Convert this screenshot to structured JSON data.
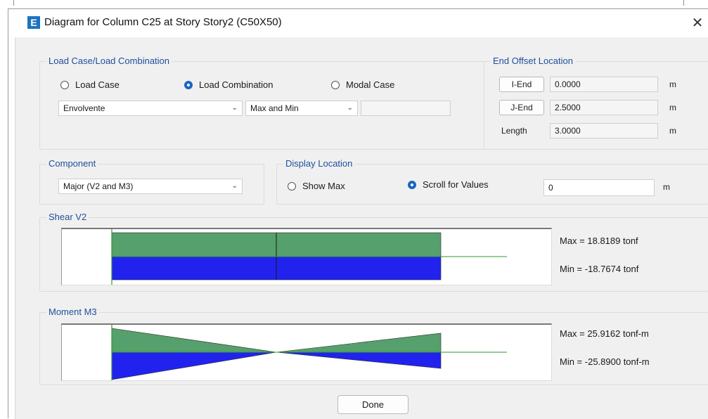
{
  "window": {
    "title": "Diagram for Column C25 at Story Story2 (C50X50)",
    "app_icon": "E",
    "close_glyph": "✕"
  },
  "load_case_group": {
    "label": "Load Case/Load Combination",
    "radios": [
      "Load Case",
      "Load Combination",
      "Modal Case"
    ],
    "selected_radio": "Load Combination",
    "combo_name": "Envolvente",
    "combo_mode": "Max and Min",
    "extra_value": ""
  },
  "end_offset": {
    "label": "End Offset Location",
    "i_end_button": "I-End",
    "i_end_value": "0.0000",
    "j_end_button": "J-End",
    "j_end_value": "2.5000",
    "length_label": "Length",
    "length_value": "3.0000",
    "unit": "m"
  },
  "component": {
    "label": "Component",
    "selected": "Major (V2 and M3)"
  },
  "display_location": {
    "label": "Display Location",
    "show_max": "Show Max",
    "scroll_for_values": "Scroll for Values",
    "selected": "Scroll for Values",
    "value": "0",
    "unit": "m"
  },
  "shear": {
    "label": "Shear V2",
    "max_text": "Max = 18.8189 tonf",
    "min_text": "Min = -18.7674 tonf",
    "max": 18.8189,
    "min": -18.7674
  },
  "moment": {
    "label": "Moment M3",
    "max_text": "Max = 25.9162 tonf-m",
    "min_text": "Min = -25.8900 tonf-m",
    "max": 25.9162,
    "min": -25.89
  },
  "done_label": "Done",
  "colors": {
    "positive_fill": "#55a06c",
    "negative_fill": "#2222ee",
    "axis_line": "#2e9a2e",
    "group_label": "#1f4e9c",
    "radio_accent": "#1a66c2"
  }
}
